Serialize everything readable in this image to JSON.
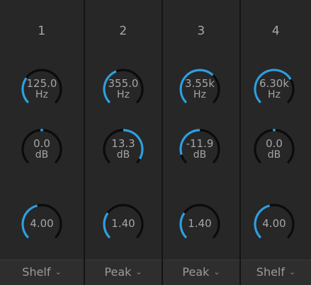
{
  "bands": [
    {
      "number": "1",
      "frequency": {
        "value": "125.0",
        "unit": "Hz",
        "level": 0.3
      },
      "gain": {
        "value": "0.0",
        "unit": "dB",
        "level": 0.0
      },
      "q": {
        "value": "4.00",
        "level": 0.45
      },
      "type": "Shelf"
    },
    {
      "number": "2",
      "frequency": {
        "value": "355.0",
        "unit": "Hz",
        "level": 0.42
      },
      "gain": {
        "value": "13.3",
        "unit": "dB",
        "level": 0.89
      },
      "q": {
        "value": "1.40",
        "level": 0.3
      },
      "type": "Peak"
    },
    {
      "number": "3",
      "frequency": {
        "value": "3.55k",
        "unit": "Hz",
        "level": 0.66
      },
      "gain": {
        "value": "-11.9",
        "unit": "dB",
        "level": -0.79
      },
      "q": {
        "value": "1.40",
        "level": 0.3
      },
      "type": "Peak"
    },
    {
      "number": "4",
      "frequency": {
        "value": "6.30k",
        "unit": "Hz",
        "level": 0.72
      },
      "gain": {
        "value": "0.0",
        "unit": "dB",
        "level": 0.0
      },
      "q": {
        "value": "4.00",
        "level": 0.45
      },
      "type": "Shelf"
    }
  ],
  "colors": {
    "accent": "#2f9fe0",
    "track": "#0b0b0b",
    "background": "#272727"
  },
  "icons": {
    "dropdown": "chevron-down-icon"
  }
}
